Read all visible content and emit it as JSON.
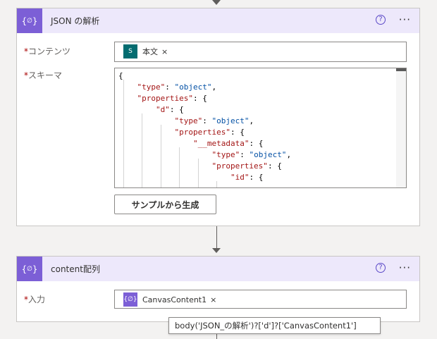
{
  "colors": {
    "header_bg": "#ede8fb",
    "action_icon_bg": "#7c5fd6",
    "sharepoint_icon_bg": "#036c70",
    "required": "#a80000"
  },
  "parse_json": {
    "title": "JSON の解析",
    "icon": "json-braces-icon",
    "help_icon": "help-circle-icon",
    "more_icon": "ellipsis-icon",
    "content_label": "コンテンツ",
    "content_token": {
      "icon": "sharepoint-icon",
      "text": "本文",
      "remove": "×"
    },
    "schema_label": "スキーマ",
    "schema_lines": [
      "{",
      "    \"type\": \"object\",",
      "    \"properties\": {",
      "        \"d\": {",
      "            \"type\": \"object\",",
      "            \"properties\": {",
      "                \"__metadata\": {",
      "                    \"type\": \"object\",",
      "                    \"properties\": {",
      "                        \"id\": {"
    ],
    "generate_button": "サンプルから生成"
  },
  "content_array": {
    "title": "content配列",
    "icon": "json-braces-icon",
    "help_icon": "help-circle-icon",
    "more_icon": "ellipsis-icon",
    "input_label": "入力",
    "input_token": {
      "icon": "json-braces-icon",
      "text": "CanvasContent1",
      "remove": "×"
    },
    "tooltip": "body('JSON_の解析')?['d']?['CanvasContent1']"
  },
  "required_mark": "*"
}
